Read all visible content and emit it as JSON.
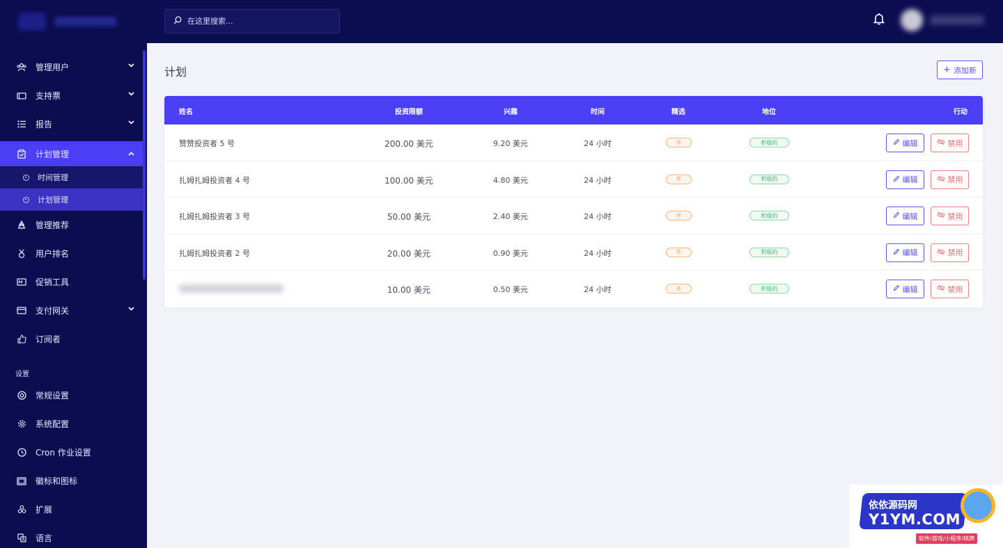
{
  "topbar": {
    "search_placeholder": "在这里搜索..."
  },
  "sidebar": {
    "items": [
      {
        "label": "管理用户",
        "icon": "users-icon",
        "has_chevron": true
      },
      {
        "label": "支持票",
        "icon": "ticket-icon",
        "has_chevron": true
      },
      {
        "label": "报告",
        "icon": "list-icon",
        "has_chevron": true
      },
      {
        "label": "计划管理",
        "icon": "clipboard-icon",
        "has_chevron": true,
        "active": true
      }
    ],
    "sub_items": [
      {
        "label": "时间管理"
      },
      {
        "label": "计划管理",
        "active": true
      }
    ],
    "items_after": [
      {
        "label": "管理推荐",
        "icon": "tree-icon"
      },
      {
        "label": "用户排名",
        "icon": "medal-icon"
      },
      {
        "label": "促销工具",
        "icon": "promo-icon"
      },
      {
        "label": "支付网关",
        "icon": "card-icon",
        "has_chevron": true
      },
      {
        "label": "订阅者",
        "icon": "thumbs-up-icon"
      }
    ],
    "section_label": "设置",
    "settings_items": [
      {
        "label": "常规设置",
        "icon": "lifebuoy-icon"
      },
      {
        "label": "系统配置",
        "icon": "gear-icon"
      },
      {
        "label": "Cron 作业设置",
        "icon": "clock-icon"
      },
      {
        "label": "徽标和图标",
        "icon": "image-icon"
      },
      {
        "label": "扩展",
        "icon": "puzzle-icon"
      },
      {
        "label": "语言",
        "icon": "language-icon"
      }
    ]
  },
  "main": {
    "page_title": "计划",
    "add_button": "添加新",
    "table": {
      "headers": [
        "姓名",
        "投资限额",
        "兴趣",
        "时间",
        "精选",
        "地位",
        "行动"
      ],
      "rows": [
        {
          "name": "赞赞投资者 5 号",
          "limit": "200.00 美元",
          "interest": "9.20 美元",
          "time": "24 小时",
          "featured": "不",
          "status": "积极的",
          "edit": "编辑",
          "ban": "禁用"
        },
        {
          "name": "扎姆扎姆投资者 4 号",
          "limit": "100.00 美元",
          "interest": "4.80 美元",
          "time": "24 小时",
          "featured": "不",
          "status": "积极的",
          "edit": "编辑",
          "ban": "禁用"
        },
        {
          "name": "扎姆扎姆投资者 3 号",
          "limit": "50.00 美元",
          "interest": "2.40 美元",
          "time": "24 小时",
          "featured": "不",
          "status": "积极的",
          "edit": "编辑",
          "ban": "禁用"
        },
        {
          "name": "扎姆扎姆投资者 2 号",
          "limit": "20.00 美元",
          "interest": "0.90 美元",
          "time": "24 小时",
          "featured": "不",
          "status": "积极的",
          "edit": "编辑",
          "ban": "禁用"
        },
        {
          "name": "",
          "limit": "10.00 美元",
          "interest": "0.50 美元",
          "time": "24 小时",
          "featured": "不",
          "status": "积极的",
          "edit": "编辑",
          "ban": "禁用"
        }
      ]
    }
  },
  "watermark": {
    "top": "依依源码网",
    "main": "Y1YM.COM",
    "sub": "软件/游戏/小程序/棋牌"
  },
  "colors": {
    "sidebar_bg": "#0c0c50",
    "accent": "#4b3ff5",
    "badge_no": "#f2a06b",
    "badge_ok": "#4eb877",
    "ban": "#ee6b6b"
  }
}
